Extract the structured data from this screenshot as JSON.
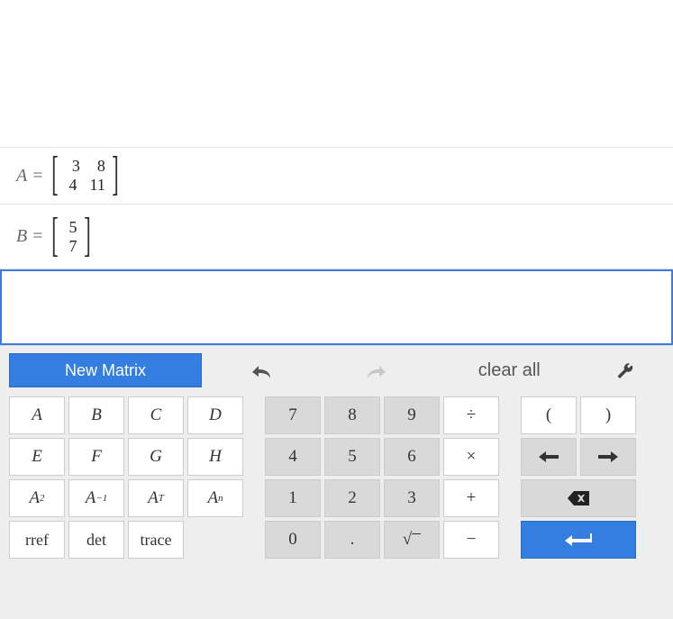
{
  "matrices": {
    "A": {
      "name": "A",
      "rows": [
        [
          "3",
          "8"
        ],
        [
          "4",
          "11"
        ]
      ]
    },
    "B": {
      "name": "B",
      "rows": [
        [
          "5"
        ],
        [
          "7"
        ]
      ]
    }
  },
  "toolbar": {
    "new_matrix": "New Matrix",
    "clear_all": "clear all"
  },
  "keys": {
    "vars": [
      "A",
      "B",
      "C",
      "D",
      "E",
      "F",
      "G",
      "H"
    ],
    "ops": {
      "sq": "A",
      "sq_sup": "2",
      "inv": "A",
      "inv_sup": "−1",
      "trans": "A",
      "trans_sup": "T",
      "pow": "A",
      "pow_sup": "n",
      "rref": "rref",
      "det": "det",
      "trace": "trace"
    },
    "digits": [
      "7",
      "8",
      "9",
      "4",
      "5",
      "6",
      "1",
      "2",
      "3",
      "0"
    ],
    "dot": ".",
    "sqrt": "√",
    "div": "÷",
    "mul": "×",
    "add": "+",
    "sub": "−",
    "lparen": "(",
    "rparen": ")",
    "left": "←",
    "right": "→"
  }
}
